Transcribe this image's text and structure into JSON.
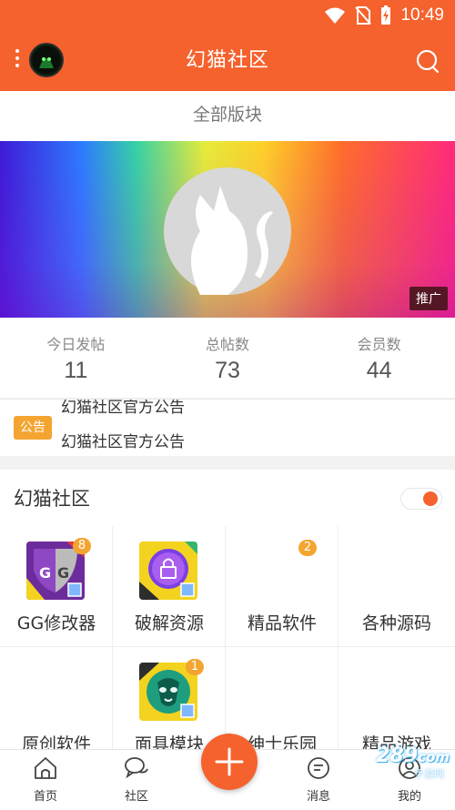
{
  "status_bar": {
    "time": "10:49"
  },
  "app_bar": {
    "title": "幻猫社区"
  },
  "section_title": "全部版块",
  "banner": {
    "tag": "推广"
  },
  "stats": [
    {
      "label": "今日发帖",
      "value": "11"
    },
    {
      "label": "总帖数",
      "value": "73"
    },
    {
      "label": "会员数",
      "value": "44"
    }
  ],
  "notice": {
    "tag": "公告",
    "previous_line": "幻猫社区官方公告",
    "current_line": "幻猫社区官方公告"
  },
  "community": {
    "title": "幻猫社区",
    "boards": [
      {
        "label": "GG修改器",
        "badge": "8",
        "icon": "gg-modifier-icon"
      },
      {
        "label": "破解资源",
        "badge": "",
        "icon": "lock-resource-icon"
      },
      {
        "label": "精品软件",
        "badge": "2",
        "icon": ""
      },
      {
        "label": "各种源码",
        "badge": "",
        "icon": ""
      },
      {
        "label": "原创软件",
        "badge": "",
        "icon": ""
      },
      {
        "label": "面具模块",
        "badge": "1",
        "icon": "magisk-mask-icon"
      },
      {
        "label": "绅士乐园",
        "badge": "",
        "icon": ""
      },
      {
        "label": "精品游戏",
        "badge": "",
        "icon": ""
      }
    ]
  },
  "bottom_nav": [
    {
      "label": "首页",
      "icon": "home-icon"
    },
    {
      "label": "社区",
      "icon": "chat-bubbles-icon"
    },
    {
      "label": "消息",
      "icon": "message-icon"
    },
    {
      "label": "我的",
      "icon": "profile-icon"
    }
  ],
  "watermark": {
    "text": "289",
    "sub": "手游网",
    "domain": "com"
  },
  "colors": {
    "accent": "#f5622d",
    "badge": "#f4a531"
  }
}
